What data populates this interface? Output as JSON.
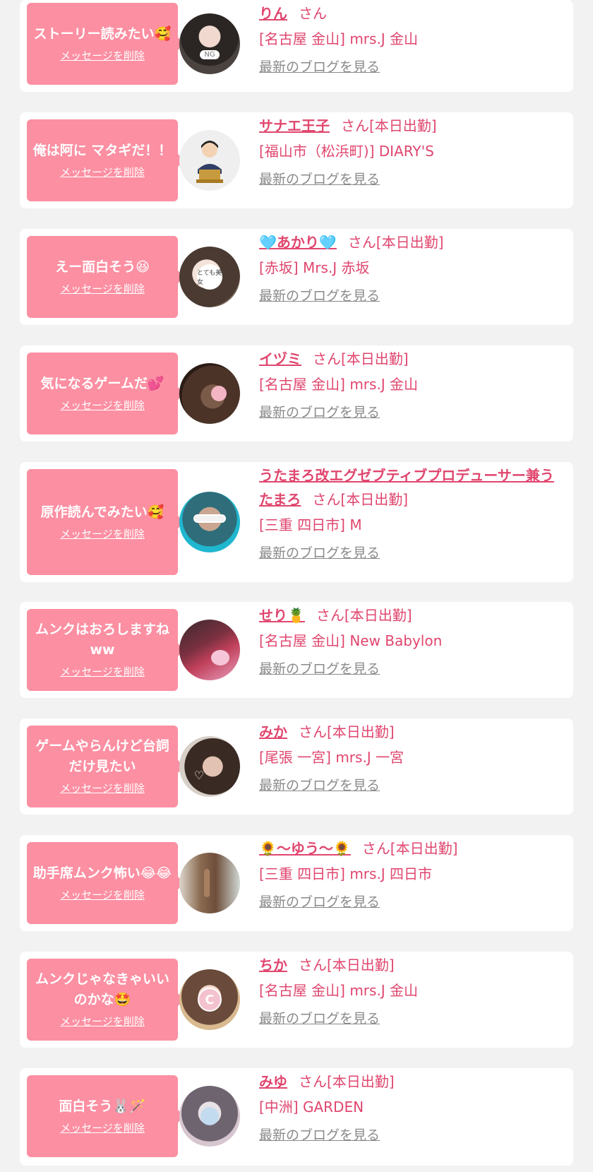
{
  "delete_label": "メッセージを削除",
  "blog_label": "最新のブログを見る",
  "colors": {
    "background": "#f2f2f2",
    "bubble": "#fc8fa2",
    "accent_text": "#e0466e",
    "link_gray": "#8a8a8a"
  },
  "entries": [
    {
      "message": "ストーリー読みたい🥰",
      "name": "りん",
      "suffix": "さん",
      "shop": "[名古屋 金山] mrs.J 金山",
      "avatar": "photo-woman-masked"
    },
    {
      "message": "俺は阿に マタギだ！！",
      "name": "サナエ王子",
      "suffix": "さん[本日出勤]",
      "shop": "[福山市（松浜町)] DIARY'S",
      "avatar": "illustration-man-podium"
    },
    {
      "message": "えー面白そう😆",
      "name": "🩵あかり🩵",
      "suffix": "さん[本日出勤]",
      "shop": "[赤坂] Mrs.J 赤坂",
      "avatar": "photo-woman-sticker"
    },
    {
      "message": "気になるゲームだ💕",
      "name": "イヅミ",
      "suffix": "さん[本日出勤]",
      "shop": "[名古屋 金山] mrs.J 金山",
      "avatar": "photo-hair-back"
    },
    {
      "message": "原作読んでみたい🥰",
      "name": "うたまろ改エグゼブティブプロデューサー兼うたまろ",
      "suffix": "さん[本日出勤]",
      "shop": "[三重 四日市] M",
      "avatar": "photo-woman-sunglasses"
    },
    {
      "message": "ムンクはおろしますねww",
      "name": "せり🍍",
      "suffix": "さん[本日出勤]",
      "shop": "[名古屋 金山] New Babylon",
      "avatar": "photo-red-hair"
    },
    {
      "message": "ゲームやらんけど台詞だけ見たい",
      "name": "みか",
      "suffix": "さん[本日出勤]",
      "shop": "[尾張 一宮] mrs.J 一宮",
      "avatar": "photo-woman-stickers"
    },
    {
      "message": "助手席ムンク怖い😂😂",
      "name": "🌻〜ゆう〜🌻",
      "suffix": "さん[本日出勤]",
      "shop": "[三重 四日市] mrs.J 四日市",
      "avatar": "photo-braided-hair"
    },
    {
      "message": "ムンクじゃなきゃいいのかな🤩",
      "name": "ちか",
      "suffix": "さん[本日出勤]",
      "shop": "[名古屋 金山] mrs.J 金山",
      "avatar": "photo-woman-c-sticker"
    },
    {
      "message": "面白そう🐰🪄",
      "name": "みゆ",
      "suffix": "さん[本日出勤]",
      "shop": "[中洲] GARDEN",
      "avatar": "photo-woman-blur"
    }
  ]
}
